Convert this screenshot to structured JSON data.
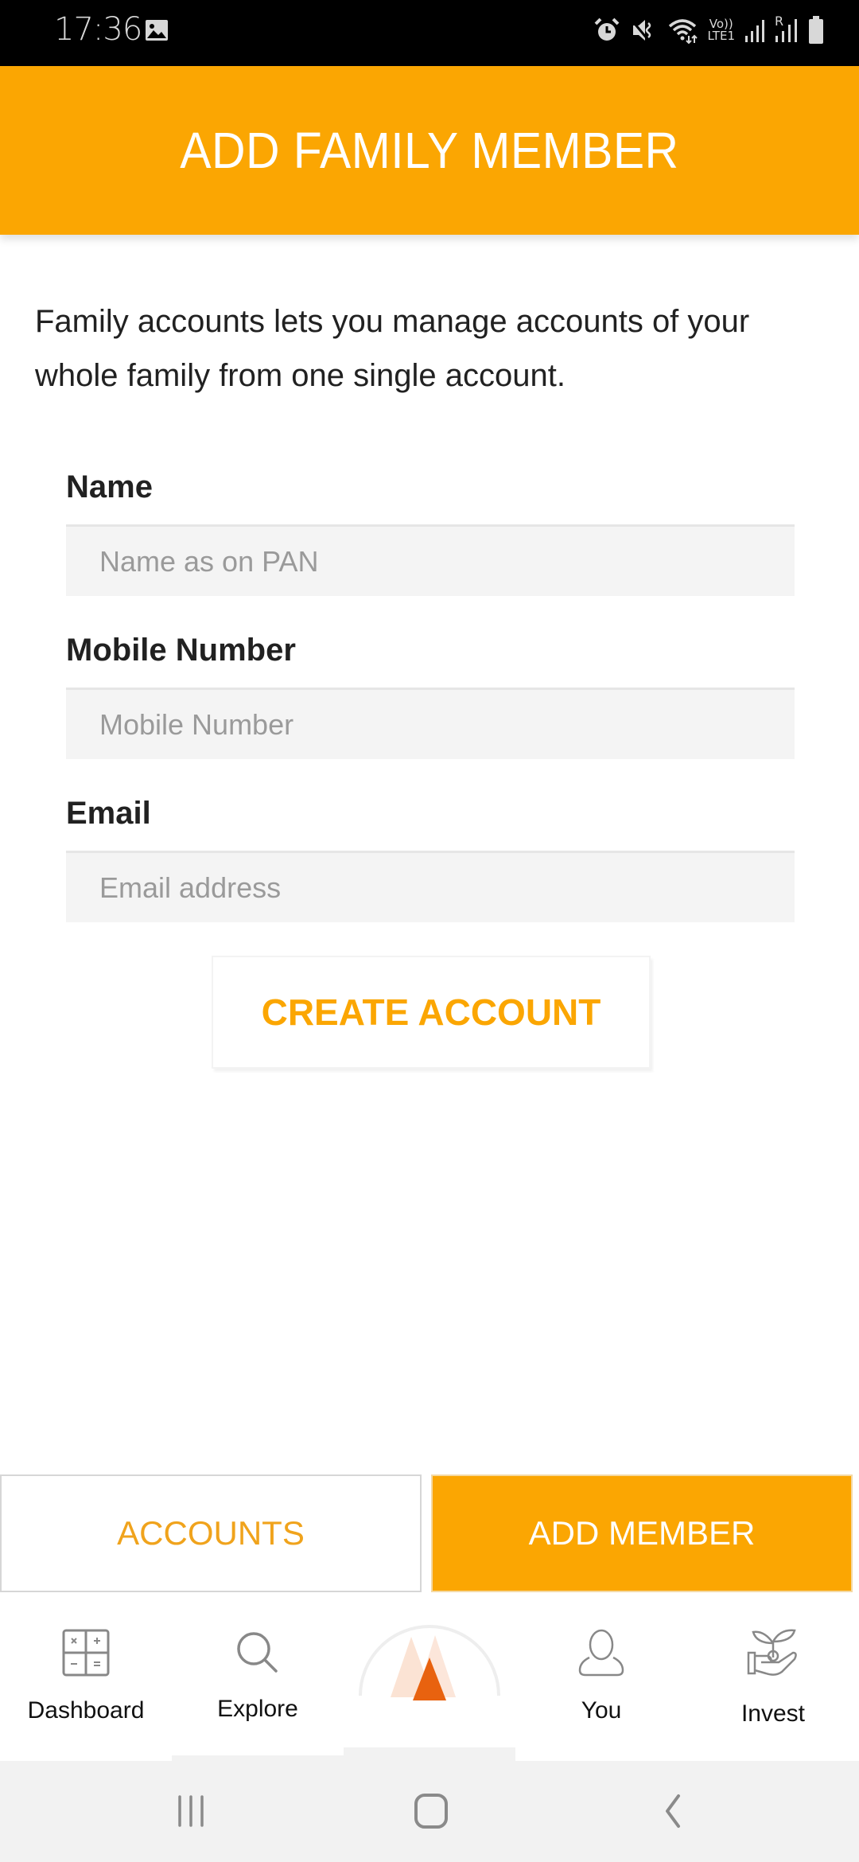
{
  "status_bar": {
    "time": "17:36",
    "left_icons": [
      "gallery-icon"
    ],
    "right_icons": [
      "alarm-icon",
      "mute-icon",
      "wifi-icon",
      "volte-lte-icon",
      "signal-sim1-icon",
      "signal-roaming-icon",
      "battery-icon"
    ],
    "volte_label_top": "Vo))",
    "volte_label_bottom": "LTE1",
    "roaming_label": "R"
  },
  "header": {
    "title": "ADD FAMILY MEMBER",
    "background_color": "#FBA602"
  },
  "description": "Family accounts lets you manage accounts of your whole family from one single account.",
  "form": {
    "fields": [
      {
        "label": "Name",
        "placeholder": "Name as on PAN",
        "value": ""
      },
      {
        "label": "Mobile Number",
        "placeholder": "Mobile Number",
        "value": ""
      },
      {
        "label": "Email",
        "placeholder": "Email address",
        "value": ""
      }
    ],
    "submit_label": "CREATE ACCOUNT"
  },
  "tabs": [
    {
      "label": "ACCOUNTS",
      "active": false
    },
    {
      "label": "ADD MEMBER",
      "active": true
    }
  ],
  "bottom_nav": [
    {
      "label": "Dashboard",
      "icon": "calculator-icon"
    },
    {
      "label": "Explore",
      "icon": "search-icon"
    },
    {
      "label": "",
      "icon": "home-logo-icon"
    },
    {
      "label": "You",
      "icon": "user-icon"
    },
    {
      "label": "Invest",
      "icon": "plant-hand-icon"
    }
  ],
  "system_nav": {
    "buttons": [
      "recent-apps-icon",
      "home-icon",
      "back-icon"
    ]
  },
  "colors": {
    "accent": "#FBA602",
    "logo": "#E8620F",
    "input_bg": "#F4F4F4"
  }
}
